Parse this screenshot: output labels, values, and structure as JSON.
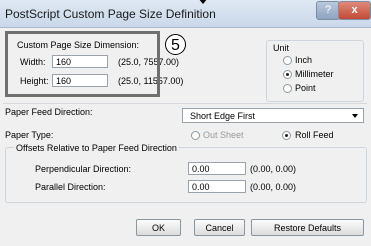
{
  "window": {
    "title": "PostScript Custom Page Size Definition",
    "help": "?",
    "close": "x"
  },
  "dimension": {
    "group_label": "Custom Page Size Dimension:",
    "width_label": "Width:",
    "width_value": "160",
    "width_range": "(25.0, 7557.00)",
    "height_label": "Height:",
    "height_value": "160",
    "height_range": "(25.0, 11557.00)"
  },
  "callout": "5",
  "unit": {
    "label": "Unit",
    "options": [
      "Inch",
      "Millimeter",
      "Point"
    ],
    "selected": "Millimeter"
  },
  "paper_feed": {
    "label": "Paper Feed Direction:",
    "value": "Short Edge First"
  },
  "paper_type": {
    "label": "Paper Type:",
    "cut_sheet": "Out Sheet",
    "roll_feed": "Roll Feed",
    "selected": "Roll Feed"
  },
  "offsets": {
    "label": "Offsets Relative to Paper Feed Direction",
    "perpendicular_label": "Perpendicular Direction:",
    "perpendicular_value": "0.00",
    "perpendicular_range": "(0.00, 0.00)",
    "parallel_label": "Parallel Direction:",
    "parallel_value": "0.00",
    "parallel_range": "(0.00, 0.00)"
  },
  "buttons": {
    "ok": "OK",
    "cancel": "Cancel",
    "restore": "Restore Defaults"
  }
}
